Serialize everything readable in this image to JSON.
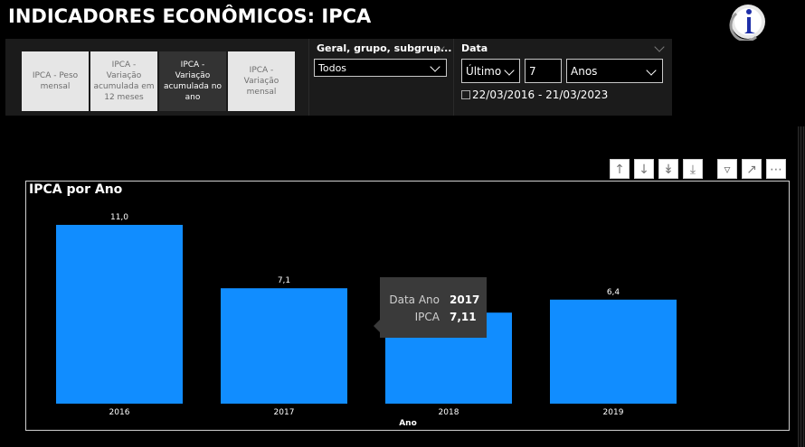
{
  "page": {
    "title": "INDICADORES ECONÔMICOS: IPCA"
  },
  "colors": {
    "bar": "#118DFF",
    "background": "#000000",
    "panel": "#1b1b1b"
  },
  "measure_slicer": {
    "options": [
      {
        "label": "IPCA - Peso mensal",
        "selected": false
      },
      {
        "label": "IPCA - Variação acumulada em 12 meses",
        "selected": false
      },
      {
        "label": "IPCA - Variação acumulada no ano",
        "selected": true
      },
      {
        "label": "IPCA - Variação mensal",
        "selected": false
      }
    ]
  },
  "group_slicer": {
    "title": "Geral, grupo, subgrup...",
    "selected": "Todos"
  },
  "date_slicer": {
    "title": "Data",
    "mode": "Último",
    "count": "7",
    "unit": "Anos",
    "range": "22/03/2016 - 21/03/2023"
  },
  "visual_header": {
    "icons": [
      "arrow-up-icon",
      "arrow-down-icon",
      "double-arrow-down-icon",
      "expand-hierarchy-icon",
      "filter-icon",
      "focus-mode-icon",
      "more-options-icon"
    ]
  },
  "chart_data": {
    "type": "bar",
    "title": "IPCA por Ano",
    "xlabel": "Ano",
    "ylabel": "",
    "categories": [
      "2016",
      "2017",
      "2018",
      "2019"
    ],
    "values": [
      11.0,
      7.1,
      5.6,
      6.4
    ],
    "data_labels": [
      "11,0",
      "7,1",
      ",6",
      "6,4"
    ],
    "ylim": [
      0,
      12
    ],
    "grid": false
  },
  "tooltip": {
    "label1": "Data Ano",
    "value1": "2017",
    "label2": "IPCA",
    "value2": "7,11"
  }
}
